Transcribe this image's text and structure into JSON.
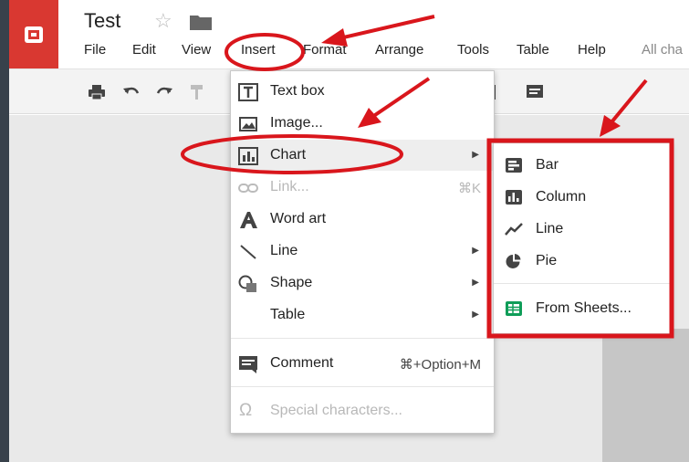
{
  "document": {
    "title": "Test"
  },
  "menubar": {
    "items": [
      "File",
      "Edit",
      "View",
      "Insert",
      "Format",
      "Arrange",
      "Tools",
      "Table",
      "Help"
    ],
    "status": "All cha"
  },
  "insert_menu": {
    "items": [
      {
        "label": "Text box",
        "icon": "text-box-icon"
      },
      {
        "label": "Image...",
        "icon": "image-icon"
      },
      {
        "label": "Chart",
        "icon": "chart-icon",
        "submenu": true
      },
      {
        "label": "Link...",
        "icon": "link-icon",
        "shortcut": "⌘K",
        "disabled": true
      },
      {
        "label": "Word art",
        "icon": "word-art-icon"
      },
      {
        "label": "Line",
        "icon": "line-icon",
        "submenu": true
      },
      {
        "label": "Shape",
        "icon": "shape-icon",
        "submenu": true
      },
      {
        "label": "Table",
        "submenu": true
      },
      {
        "label": "Comment",
        "icon": "comment-icon",
        "shortcut": "⌘+Option+M"
      },
      {
        "label": "Special characters...",
        "icon": "omega-icon",
        "disabled": true
      }
    ]
  },
  "chart_submenu": {
    "items": [
      {
        "label": "Bar",
        "icon": "bar-chart-icon"
      },
      {
        "label": "Column",
        "icon": "column-chart-icon"
      },
      {
        "label": "Line",
        "icon": "line-chart-icon"
      },
      {
        "label": "Pie",
        "icon": "pie-chart-icon"
      },
      {
        "label": "From Sheets...",
        "icon": "sheets-icon"
      }
    ]
  },
  "colors": {
    "brand_red": "#d93831",
    "annotation_red": "#d9161c",
    "sheets_green": "#0f9d58",
    "frame": "#38414b"
  }
}
